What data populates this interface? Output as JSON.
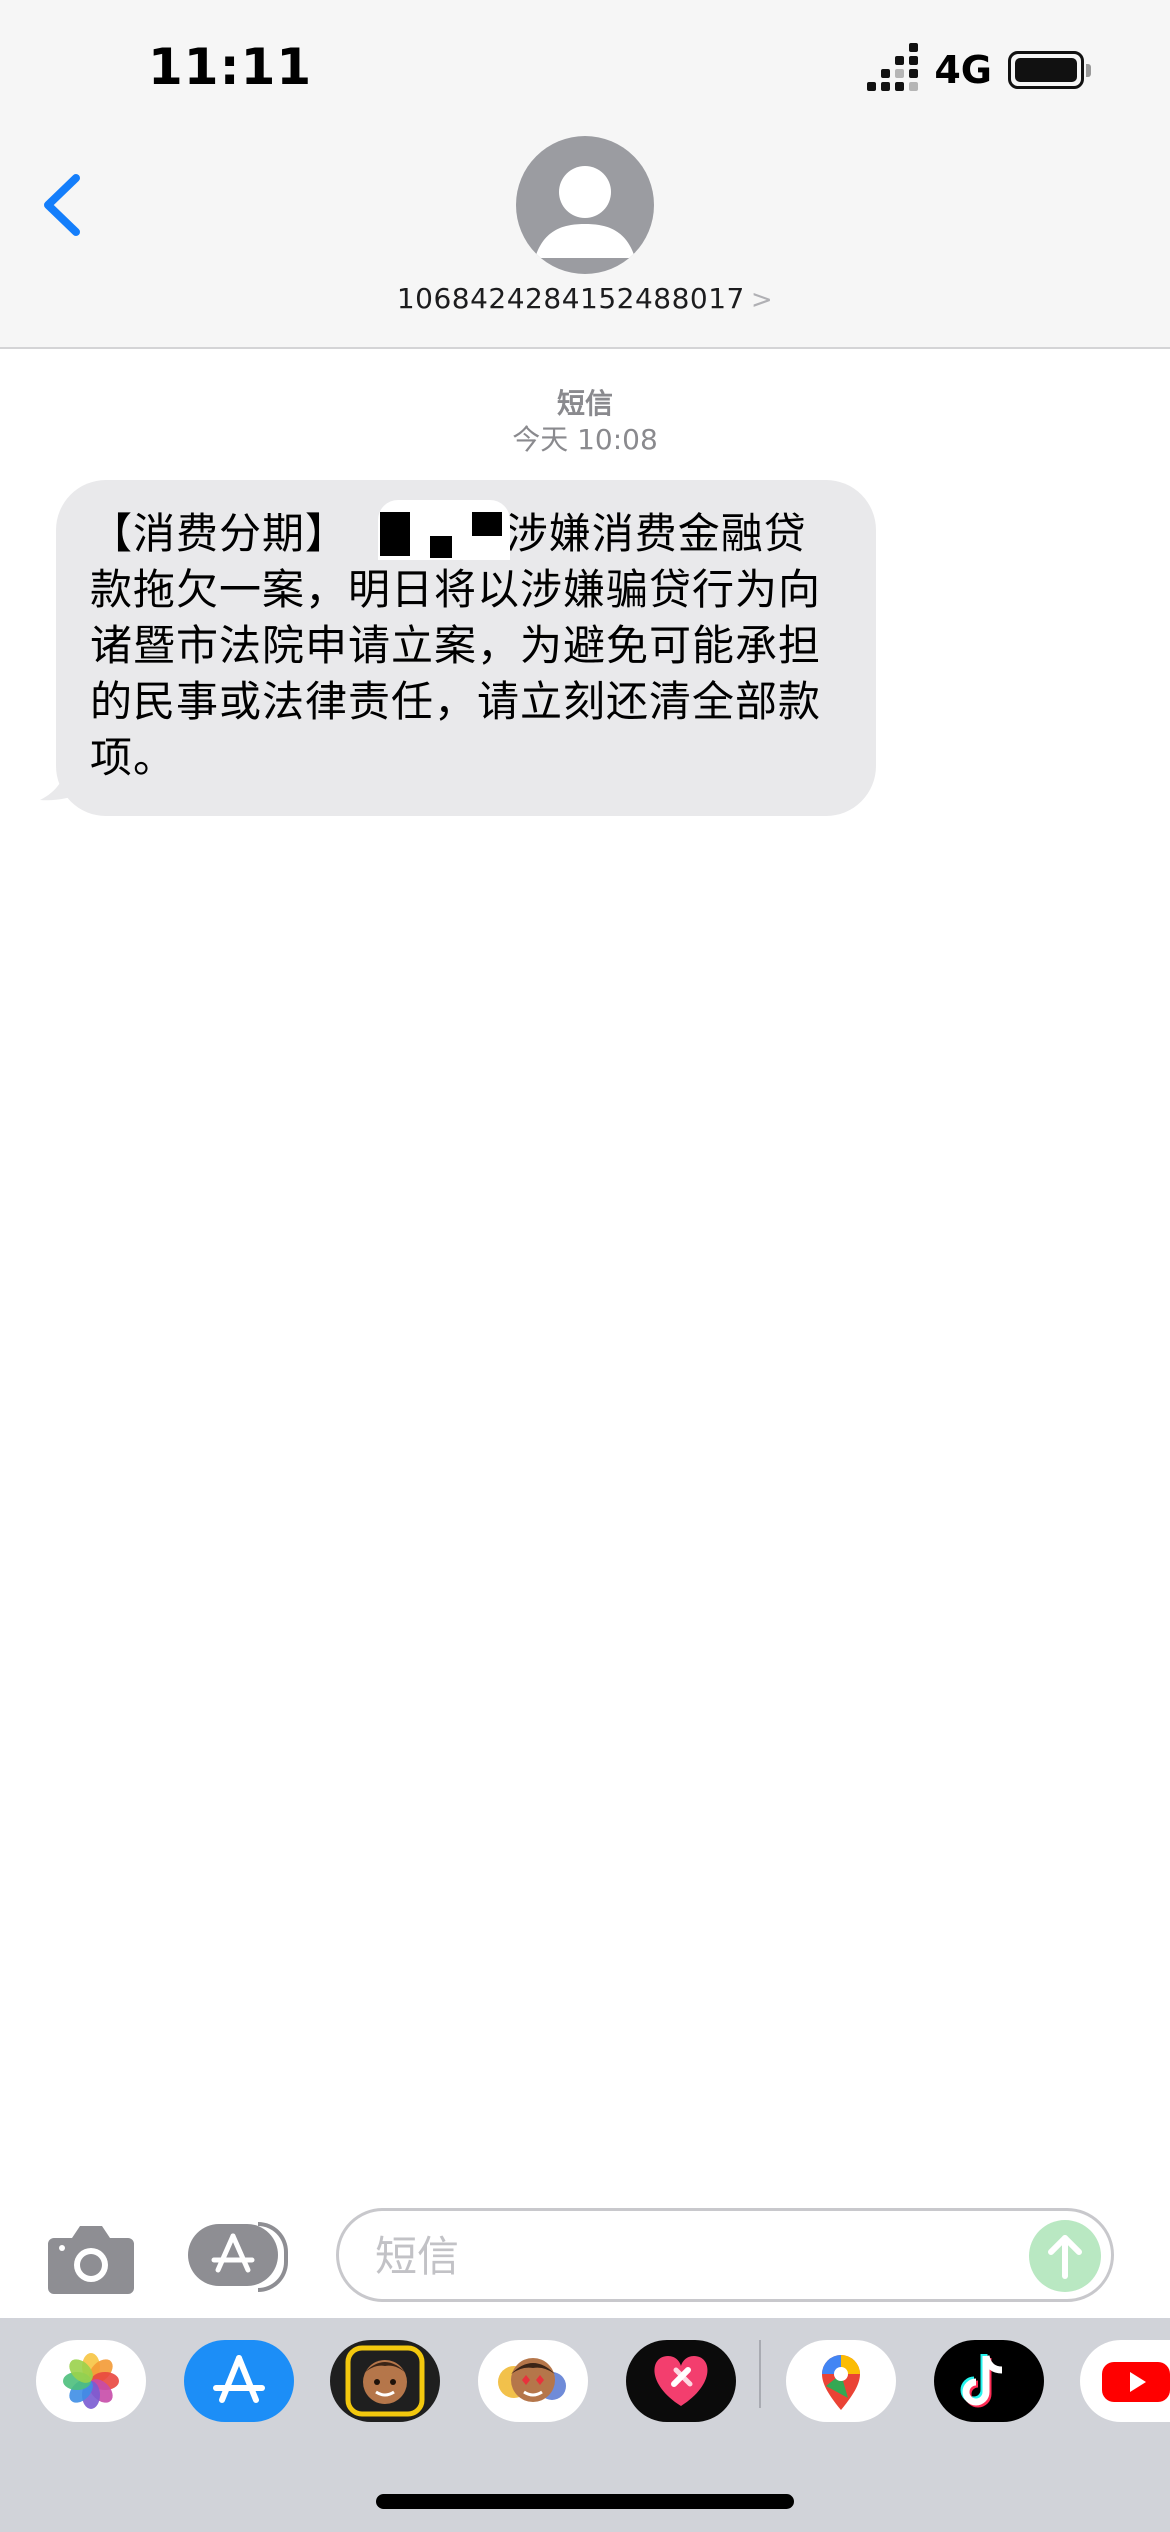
{
  "status_bar": {
    "time": "11:11",
    "network": "4G"
  },
  "header": {
    "contact": "1068424284152488017",
    "chevron": ">"
  },
  "conversation": {
    "message_type": "短信",
    "timestamp": "今天 10:08",
    "messages": [
      {
        "direction": "incoming",
        "text": "【消费分期】        因涉嫌消费金融贷款拖欠一案，明日将以涉嫌骗贷行为向诸暨市法院申请立案，为避免可能承担的民事或法律责任，请立刻还清全部款项。"
      }
    ]
  },
  "input_bar": {
    "placeholder": "短信"
  },
  "app_drawer": {
    "apps": [
      "photos-icon",
      "app-store-icon",
      "memoji-icon",
      "animoji-stickers-icon",
      "heart-app-icon",
      "google-maps-icon",
      "tiktok-icon",
      "youtube-icon"
    ]
  },
  "colors": {
    "accent": "#147efb",
    "bubble_incoming": "#e9e9eb",
    "header_bg": "#f6f6f6",
    "drawer_bg": "#d1d3d9"
  }
}
